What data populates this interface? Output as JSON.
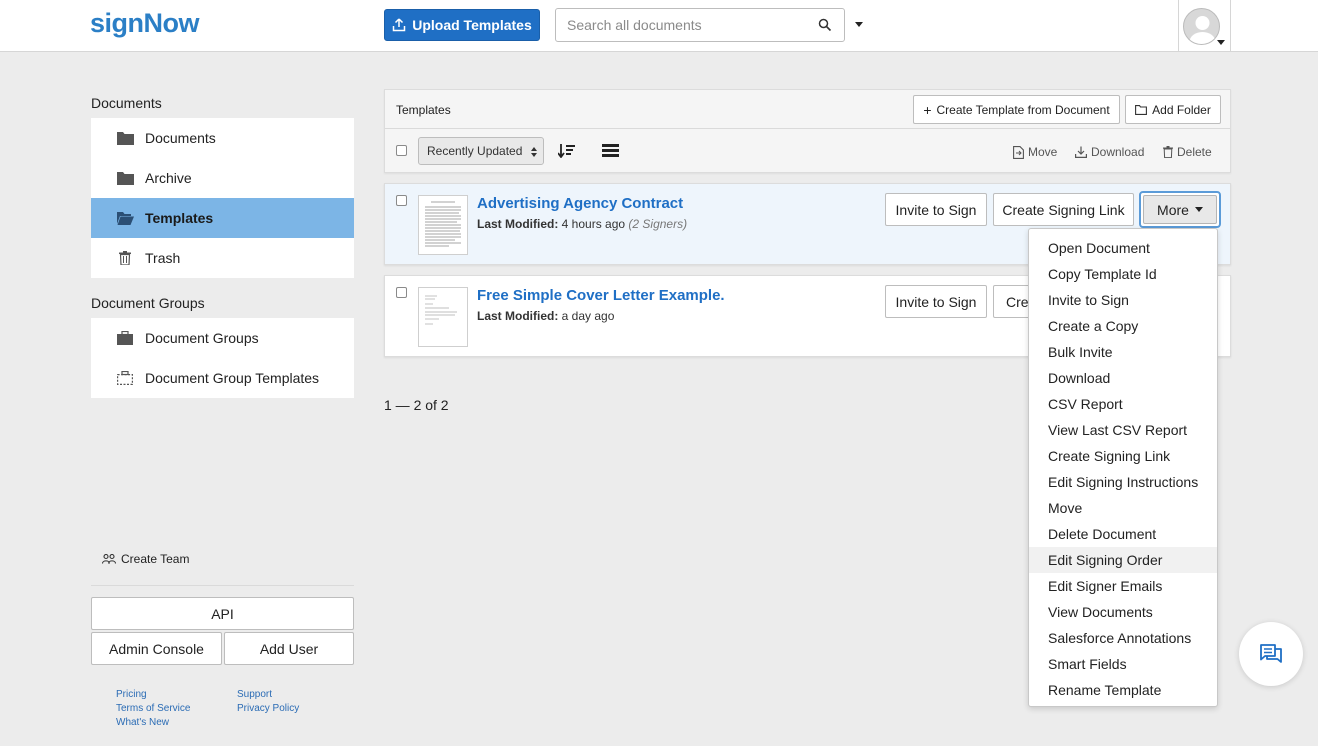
{
  "header": {
    "logo": "signNow",
    "upload_label": "Upload Templates",
    "search_placeholder": "Search all documents"
  },
  "sidebar": {
    "documents_heading": "Documents",
    "documents_items": [
      {
        "label": "Documents",
        "icon": "folder-icon"
      },
      {
        "label": "Archive",
        "icon": "folder-icon"
      },
      {
        "label": "Templates",
        "icon": "open-folder-icon",
        "active": true
      },
      {
        "label": "Trash",
        "icon": "trash-icon"
      }
    ],
    "groups_heading": "Document Groups",
    "groups_items": [
      {
        "label": "Document Groups",
        "icon": "briefcase-icon"
      },
      {
        "label": "Document Group Templates",
        "icon": "group-template-icon"
      }
    ],
    "create_team": "Create Team",
    "api_label": "API",
    "admin_console_label": "Admin Console",
    "add_user_label": "Add User",
    "footer_left": [
      "Pricing",
      "Terms of Service",
      "What's New"
    ],
    "footer_right": [
      "Support",
      "Privacy Policy"
    ]
  },
  "toolbar": {
    "title": "Templates",
    "create_from_doc": "Create Template from Document",
    "add_folder": "Add Folder",
    "sort_value": "Recently Updated",
    "move": "Move",
    "download": "Download",
    "delete": "Delete"
  },
  "rows": [
    {
      "title": "Advertising Agency Contract",
      "modified_label": "Last Modified:",
      "modified_value": "4 hours ago",
      "signers": "(2 Signers)",
      "invite": "Invite to Sign",
      "signing_link": "Create Signing Link",
      "more": "More"
    },
    {
      "title": "Free Simple Cover Letter Example.",
      "modified_label": "Last Modified:",
      "modified_value": "a day ago",
      "invite": "Invite to Sign",
      "signing_link": "Create Signing Link"
    }
  ],
  "pagination": "1 — 2 of 2",
  "dropdown": [
    "Open Document",
    "Copy Template Id",
    "Invite to Sign",
    "Create a Copy",
    "Bulk Invite",
    "Download",
    "CSV Report",
    "View Last CSV Report",
    "Create Signing Link",
    "Edit Signing Instructions",
    "Move",
    "Delete Document",
    "Edit Signing Order",
    "Edit Signer Emails",
    "View Documents",
    "Salesforce Annotations",
    "Smart Fields",
    "Rename Template"
  ],
  "colors": {
    "brand": "#2b7fc6",
    "primary_button": "#1f6fc5",
    "active_sidebar": "#7cb5e6",
    "link": "#1f6fc5"
  }
}
